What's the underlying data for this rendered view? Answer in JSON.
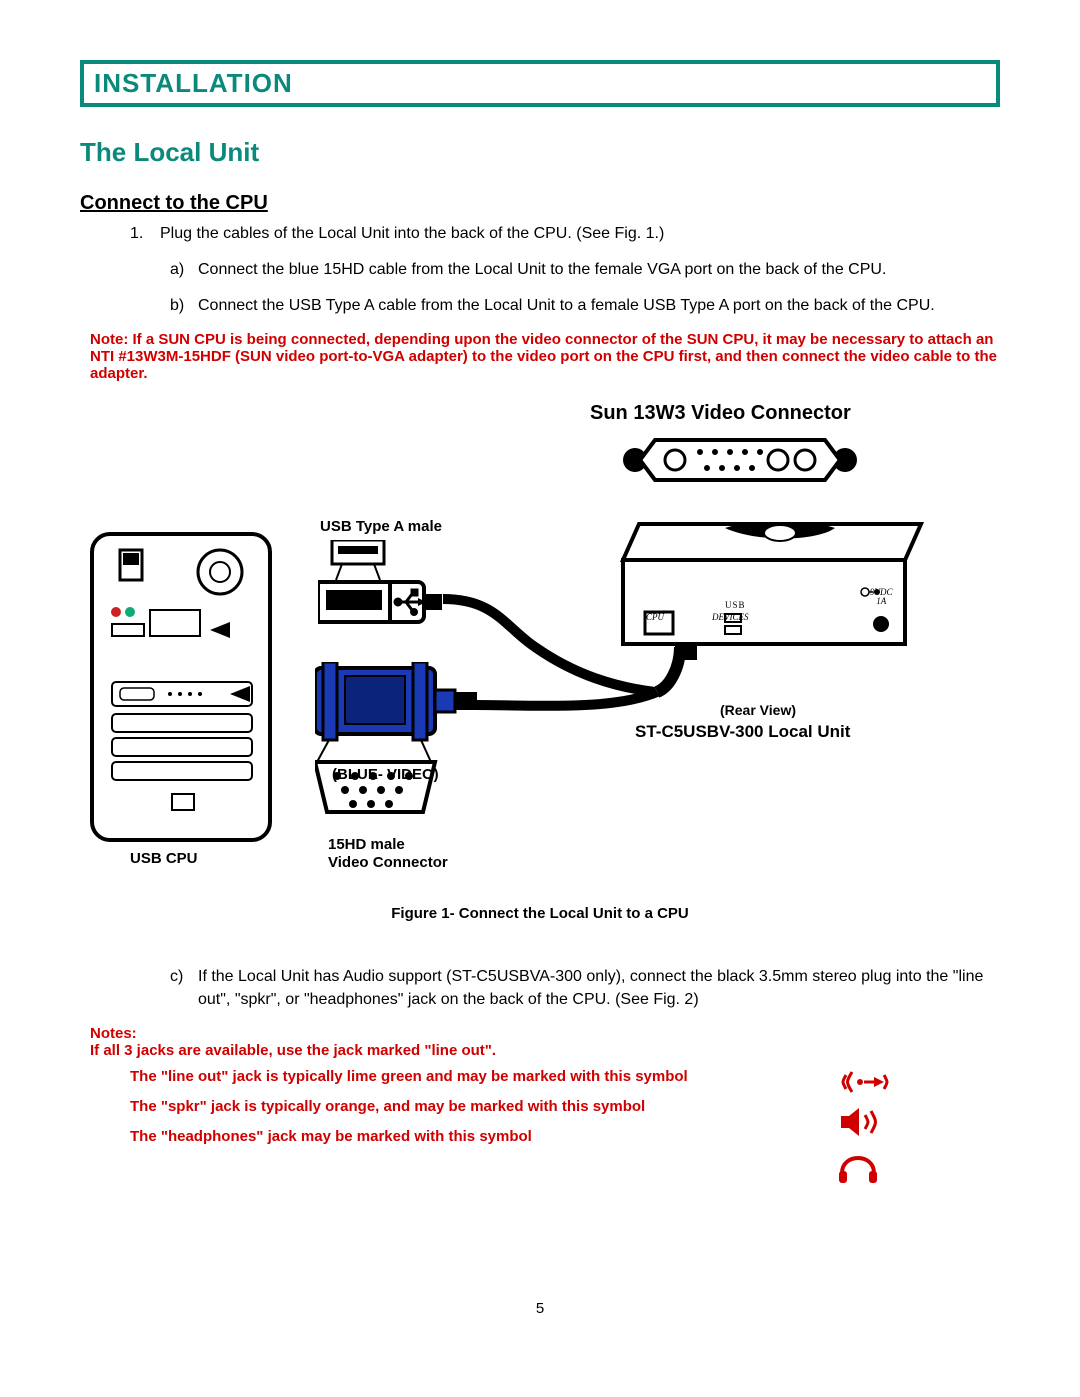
{
  "section_title": "INSTALLATION",
  "h2": "The Local Unit",
  "h3": "Connect to the CPU",
  "step1_num": "1.",
  "step1": "Plug the cables of the Local Unit into the back of the CPU.  (See Fig. 1.)",
  "sub_a_lbl": "a)",
  "sub_a": "Connect the blue 15HD cable from the Local Unit to the female VGA port on the back of the CPU.",
  "sub_b_lbl": "b)",
  "sub_b": "Connect the USB Type A cable from the Local Unit to a female USB Type A port on the back of the CPU.",
  "note1_pt1": "Note: If a SUN CPU is being connected, depending upon the video connector of the SUN CPU, it may be necessary to attach an NTI #13W3M-15HDF (SUN video port-to-VGA adapter) to the video port on the CPU first, and then connect the video cable to the adapter.",
  "fig": {
    "sun_title": "Sun 13W3 Video Connector",
    "usb_label": "USB Type A male",
    "blue_video": "(BLUE- VIDEO)",
    "hd15_line1": "15HD male",
    "hd15_line2": "Video Connector",
    "usb_cpu": "USB CPU",
    "rear_view": "(Rear View)",
    "local_unit": "ST-C5USBV-300 Local Unit",
    "dev_cpu": "CPU",
    "dev_usb": "USB",
    "dev_devices": "DEVICES",
    "dev_power": "9VDC\n1A",
    "caption": "Figure 1- Connect the Local Unit to a CPU"
  },
  "sub_c_lbl": "c)",
  "sub_c": "If the Local Unit has Audio support (ST-C5USBVA-300 only), connect the black 3.5mm stereo plug into the \"line out\",  \"spkr\", or \"headphones\" jack on the back of the CPU.  (See Fig. 2)",
  "note2_title": "Notes:",
  "note2_intro": "If all 3 jacks are available, use the jack marked \"line out\".",
  "note2_a": "The   \"line out\"   jack   is   typically   lime   green   and   may   be   marked   with   this   symbol",
  "note2_b": "The       \"spkr\"       jack       is       typically       orange,       and       may       be       marked       with       this       symbol",
  "note2_c": "The \"headphones\" jack may be marked with this symbol",
  "page_number": "5"
}
